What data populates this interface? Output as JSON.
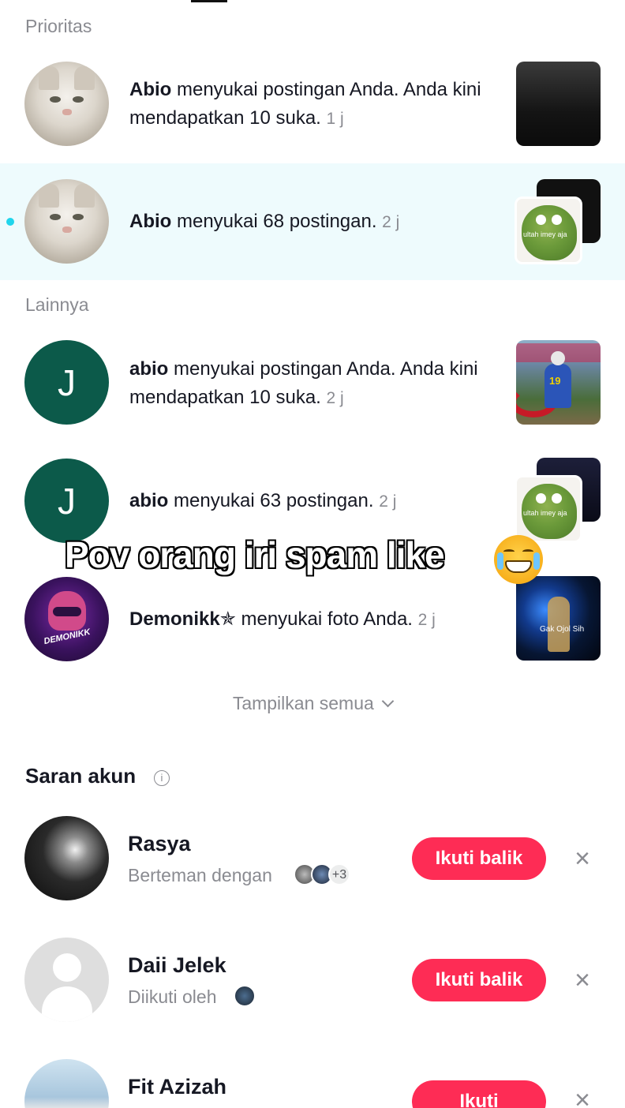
{
  "sections": {
    "priority": "Prioritas",
    "others": "Lainnya"
  },
  "notifications": [
    {
      "user": "Abio",
      "action": " menyukai postingan Anda. Anda kini mendapatkan 10 suka.",
      "time": "1 j"
    },
    {
      "user": "Abio",
      "action": " menyukai 68 postingan.",
      "time": "2 j"
    },
    {
      "user": "abio",
      "action": " menyukai postingan Anda. Anda kini mendapatkan 10 suka.",
      "time": "2 j",
      "avatar_letter": "J"
    },
    {
      "user": "abio",
      "action": " menyukai 63 postingan.",
      "time": "2 j",
      "avatar_letter": "J"
    },
    {
      "user": "Demonikk✯",
      "action": " menyukai foto Anda.",
      "time": "2 j",
      "avatar_text": "DEMONIKK"
    }
  ],
  "thumbnails": {
    "stack_caption": "ultah imey aja",
    "neon_caption": "Gak Ojol Sih"
  },
  "show_all": "Tampilkan semua",
  "suggestions": {
    "title": "Saran akun",
    "items": [
      {
        "name": "Rasya",
        "subtitle": "Berteman dengan",
        "extra_count": "+3",
        "button": "Ikuti balik"
      },
      {
        "name": "Daii Jelek",
        "subtitle": "Diikuti oleh",
        "button": "Ikuti balik"
      },
      {
        "name": "Fit Azizah",
        "subtitle": "",
        "button": "Ikuti"
      }
    ]
  },
  "overlay": {
    "caption": "Pov orang iri spam like",
    "emoji": "crying-laughing-cat-emoji"
  },
  "colors": {
    "accent": "#fe2c55",
    "unread": "#20d5ec",
    "highlight_bg": "#eefbfd",
    "letter_avatar": "#0c5a4a"
  }
}
